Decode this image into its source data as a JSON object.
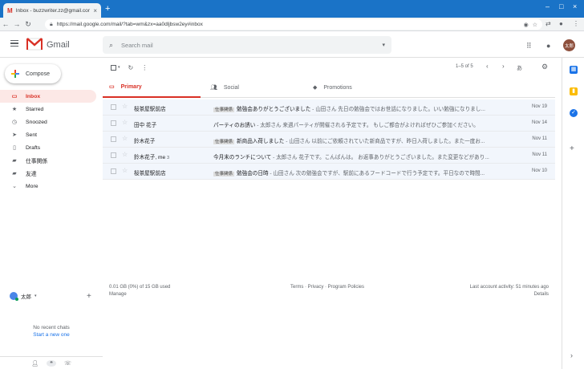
{
  "browser": {
    "tab_title": "Inbox - buzzwriter.zz@gmail.com",
    "url": "https://mail.google.com/mail/?tab=wm&zx=aa0dljbsw2ey#inbox"
  },
  "gmail": {
    "brand": "Gmail",
    "search_placeholder": "Search mail",
    "avatar_text": "太郎"
  },
  "sidebar": {
    "compose": "Compose",
    "items": [
      {
        "label": "Inbox",
        "icon": "inbox-icon",
        "glyph": "▭"
      },
      {
        "label": "Starred",
        "icon": "star-icon",
        "glyph": "★"
      },
      {
        "label": "Snoozed",
        "icon": "clock-icon",
        "glyph": "◷"
      },
      {
        "label": "Sent",
        "icon": "send-icon",
        "glyph": "➤"
      },
      {
        "label": "Drafts",
        "icon": "draft-icon",
        "glyph": "▯"
      },
      {
        "label": "仕事関係",
        "icon": "label-icon",
        "glyph": "▰"
      },
      {
        "label": "友達",
        "icon": "label-icon",
        "glyph": "▰"
      },
      {
        "label": "More",
        "icon": "chevron-down-icon",
        "glyph": "⌄"
      }
    ],
    "hangouts_user": "太郎",
    "no_chats": "No recent chats",
    "start_new": "Start a new one"
  },
  "toolbar": {
    "pager": "1–5 of 5",
    "input_tool": "あ"
  },
  "category_tabs": [
    "Primary",
    "Social",
    "Promotions"
  ],
  "emails": [
    {
      "sender": "桜茶屋駅前店",
      "label": "仕事関係",
      "subject": "勉強会ありがとうございました",
      "snippet": " - 山田さん 先日の勉強会ではお世話になりました。いい勉強になりまし...",
      "date": "Nov 19"
    },
    {
      "sender": "田中 花子",
      "label": "",
      "subject": "パーティのお誘い",
      "snippet": " - 太郎さん 来週パーティが開催される予定です。 もしご都合がよければぜひご参加ください。",
      "date": "Nov 14"
    },
    {
      "sender": "鈴木花子",
      "label": "仕事関係",
      "subject": "新商品入荷しました",
      "snippet": " - 山田さん 以前にご依頼されていた新商品ですが、昨日入荷しました。また一度お...",
      "date": "Nov 11"
    },
    {
      "sender": "鈴木花子, me",
      "count": "3",
      "label": "",
      "subject": "今月末のランチについて",
      "snippet": " - 太郎さん 花子です。こんばんは。 お返事ありがとうございました。また変更などがあり...",
      "date": "Nov 11"
    },
    {
      "sender": "桜茶屋駅前店",
      "label": "仕事関係",
      "subject": "勉強会の日時",
      "snippet": " - 山田さん 次の勉強会ですが、駅前にあるフードコードで行う予定です。平日なので時間...",
      "date": "Nov 10"
    }
  ],
  "footer": {
    "storage": "0.01 GB (0%) of 15 GB used",
    "manage": "Manage",
    "terms": "Terms · Privacy · Program Policies",
    "activity": "Last account activity: 51 minutes ago",
    "details": "Details"
  }
}
